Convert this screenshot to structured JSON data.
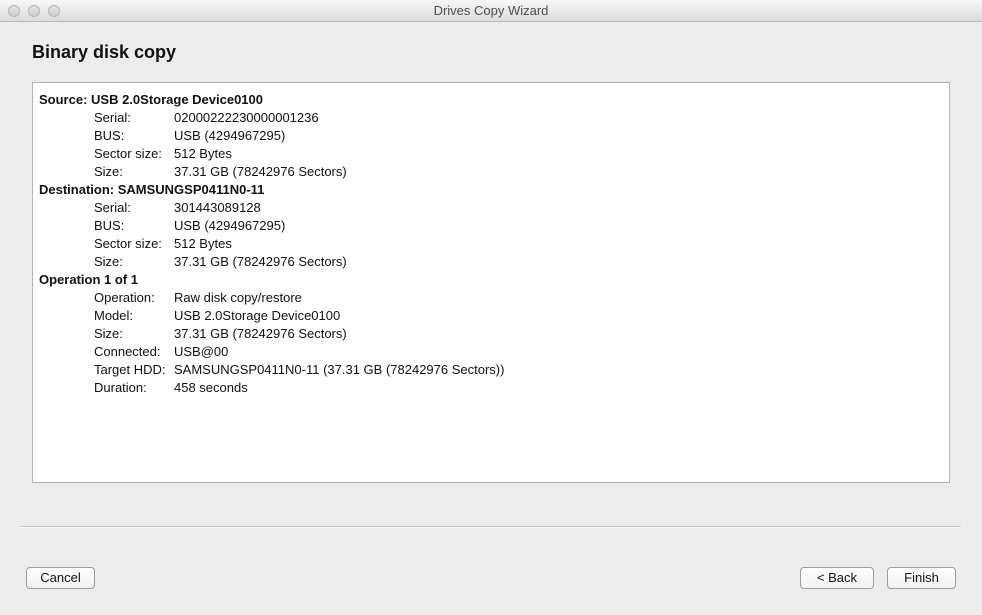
{
  "window": {
    "title": "Drives Copy Wizard"
  },
  "page": {
    "title": "Binary disk copy"
  },
  "sections": [
    {
      "heading": "Source: USB 2.0Storage Device0100",
      "rows": [
        {
          "label": "Serial:",
          "value": "02000222230000001236"
        },
        {
          "label": "BUS:",
          "value": "USB (4294967295)"
        },
        {
          "label": "Sector size:",
          "value": "512 Bytes"
        },
        {
          "label": "Size:",
          "value": "37.31 GB (78242976 Sectors)"
        }
      ]
    },
    {
      "heading": "Destination: SAMSUNGSP0411N0-11",
      "rows": [
        {
          "label": "Serial:",
          "value": "301443089128"
        },
        {
          "label": "BUS:",
          "value": "USB (4294967295)"
        },
        {
          "label": "Sector size:",
          "value": "512 Bytes"
        },
        {
          "label": "Size:",
          "value": "37.31 GB (78242976 Sectors)"
        }
      ]
    },
    {
      "heading": "Operation 1 of 1",
      "rows": [
        {
          "label": "Operation:",
          "value": "Raw disk copy/restore"
        },
        {
          "label": "Model:",
          "value": "USB 2.0Storage Device0100"
        },
        {
          "label": "Size:",
          "value": "37.31 GB (78242976 Sectors)"
        },
        {
          "label": "Connected:",
          "value": "USB@00"
        },
        {
          "label": "Target HDD:",
          "value": "SAMSUNGSP0411N0-11 (37.31 GB (78242976 Sectors))"
        },
        {
          "label": "Duration:",
          "value": "458 seconds"
        }
      ]
    }
  ],
  "buttons": {
    "cancel": "Cancel",
    "back": "< Back",
    "finish": "Finish"
  }
}
